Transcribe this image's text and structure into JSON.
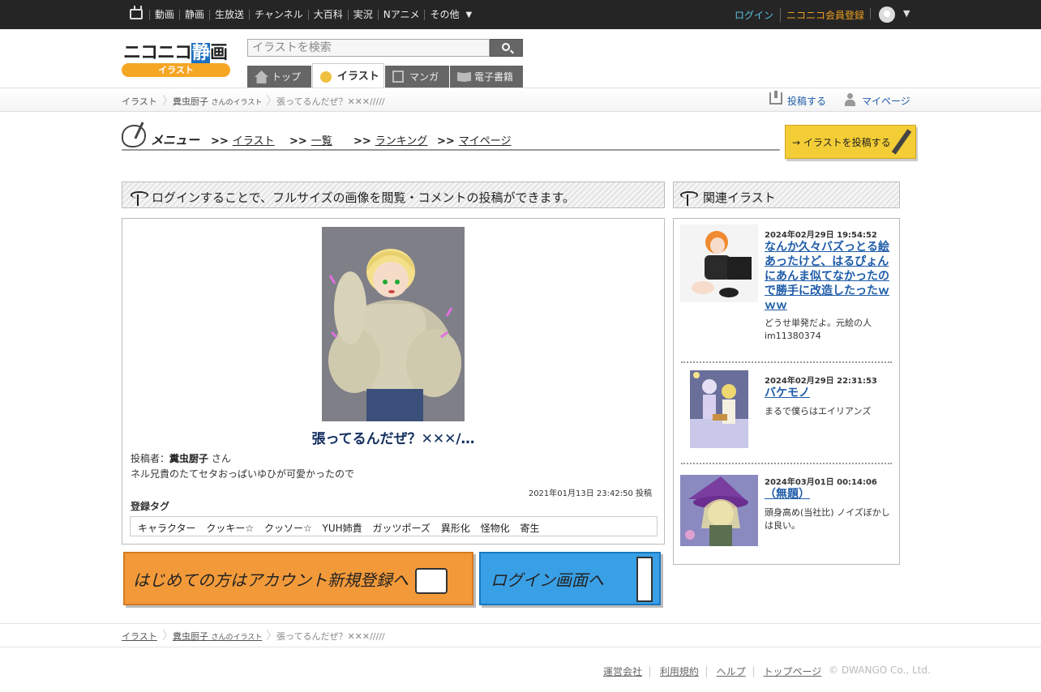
{
  "topbar": {
    "nav": [
      "動画",
      "静画",
      "生放送",
      "チャンネル",
      "大百科",
      "実況",
      "Nアニメ",
      "その他"
    ],
    "login": "ログイン",
    "register": "ニコニコ会員登録"
  },
  "header": {
    "logo_main": "ニコニコ",
    "logo_accent": "静",
    "logo_end": "画",
    "logo_sub": "イラスト",
    "search_placeholder": "イラストを検索",
    "tabs": [
      "トップ",
      "イラスト",
      "マンガ",
      "電子書籍"
    ]
  },
  "breadcrumb": {
    "root": "イラスト",
    "author": "糞虫厨子",
    "author_suffix": "さんのイラスト",
    "current": "張ってるんだぜ？✕✕✕/////"
  },
  "userlinks": {
    "post": "投稿する",
    "mypage": "マイページ"
  },
  "menu": {
    "label": "メニュー",
    "arrow": ">>",
    "items": [
      "イラスト",
      "一覧",
      "ランキング",
      "マイページ"
    ],
    "upload_banner": "イラストを投稿する"
  },
  "notice": "ログインすることで、フルサイズの画像を閲覧・コメントの投稿ができます。",
  "artwork": {
    "title": "張ってるんだぜ？✕✕✕/…",
    "poster_label": "投稿者：",
    "poster": "糞虫厨子",
    "poster_suffix": "さん",
    "description": "ネル兄貴のたてセタおっぱいゆひが可愛かったので",
    "posted_at": "2021年01月13日 23:42:50 投稿",
    "tags_label": "登録タグ",
    "tags": [
      "キャラクター",
      "クッキー☆",
      "クッソー☆",
      "YUH姉貴",
      "ガッツポーズ",
      "異形化",
      "怪物化",
      "寄生"
    ]
  },
  "banners": {
    "register": "はじめての方はアカウント新規登録へ",
    "login": "ログイン画面へ"
  },
  "sidebar": {
    "title": "関連イラスト",
    "items": [
      {
        "date": "2024年02月29日 19:54:52",
        "title": "なんか久々バズっとる絵あったけど、はるぴょんにあんま似てなかったので勝手に改造したったｗｗｗ",
        "desc": "どうせ単発だよ。元絵の人 im11380374"
      },
      {
        "date": "2024年02月29日 22:31:53",
        "title": "バケモノ",
        "desc": "まるで僕らはエイリアンズ"
      },
      {
        "date": "2024年03月01日 00:14:06",
        "title": "（無題）",
        "desc": "頭身高め(当社比) ノイズぼかしは良い。"
      }
    ]
  },
  "footer": {
    "crumb_root": "イラスト",
    "crumb_author": "糞虫厨子",
    "crumb_author_suffix": "さんのイラスト",
    "crumb_current": "張ってるんだぜ？✕✕✕/////",
    "links": [
      "運営会社",
      "利用規約",
      "ヘルプ",
      "トップページ"
    ],
    "copyright": "© DWANGO Co., Ltd."
  },
  "colors": {
    "topbar": "#252525",
    "accent_orange": "#f5a623",
    "link_blue": "#1e5ca8",
    "title_navy": "#153060"
  }
}
